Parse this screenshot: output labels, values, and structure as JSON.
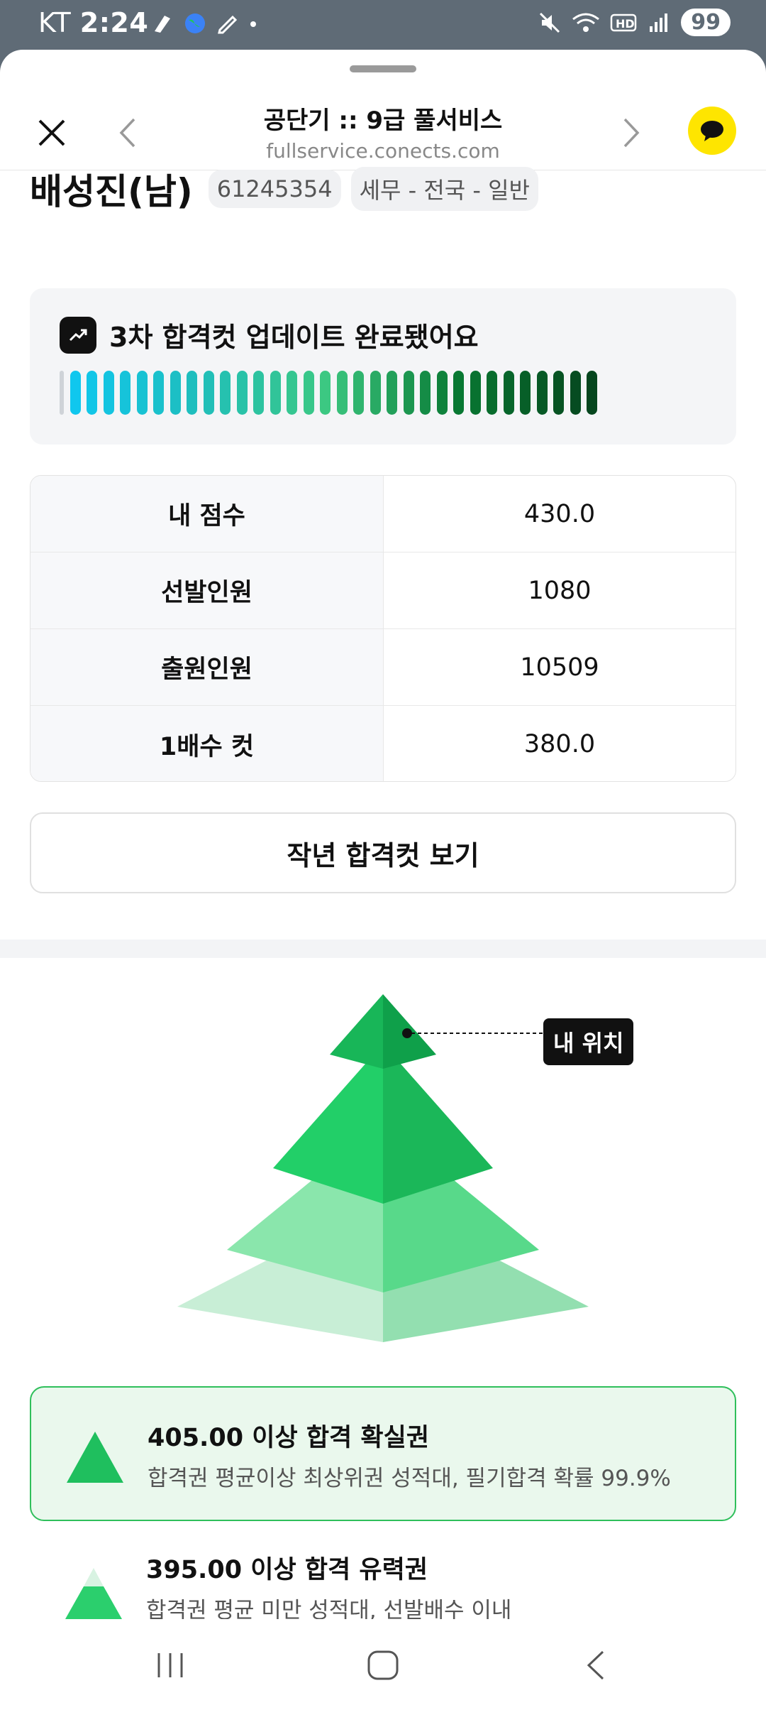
{
  "status": {
    "carrier": "KT",
    "time": "2:24",
    "battery": "99"
  },
  "header": {
    "title": "공단기 :: 9급 풀서비스",
    "url": "fullservice.conects.com"
  },
  "profile": {
    "name": "배성진(남)",
    "id": "61245354",
    "category": "세무 - 전국 - 일반"
  },
  "update": {
    "text": "3차 합격컷 업데이트 완료됐어요",
    "bar_count": 33
  },
  "table": [
    {
      "label": "내 점수",
      "value": "430.0"
    },
    {
      "label": "선발인원",
      "value": "1080"
    },
    {
      "label": "출원인원",
      "value": "10509"
    },
    {
      "label": "1배수 컷",
      "value": "380.0"
    }
  ],
  "last_year_button": "작년 합격컷 보기",
  "my_position_label": "내 위치",
  "tiers": [
    {
      "title": "405.00 이상 합격 확실권",
      "desc": "합격권 평균이상 최상위권 성적대, 필기합격 확률 99.9%"
    },
    {
      "title": "395.00 이상 합격 유력권",
      "desc": "합격권 평균 미만 성적대, 선발배수 이내"
    }
  ],
  "colors": {
    "accent": "#22c55e",
    "kakao": "#fee500"
  }
}
